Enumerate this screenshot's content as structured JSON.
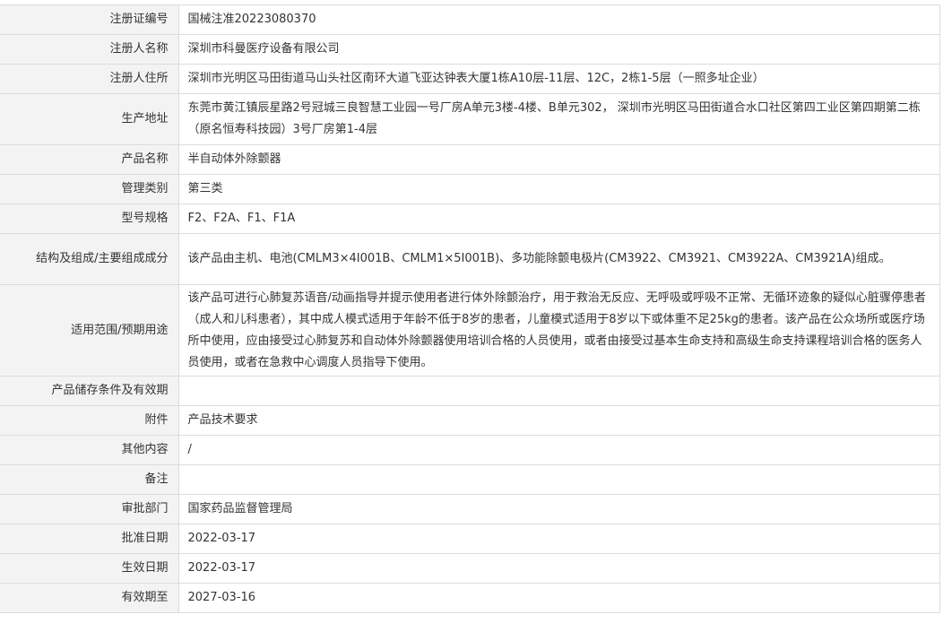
{
  "record": {
    "rows": [
      {
        "label": "注册证编号",
        "value": "国械注准20223080370"
      },
      {
        "label": "注册人名称",
        "value": "深圳市科曼医疗设备有限公司"
      },
      {
        "label": "注册人住所",
        "value": "深圳市光明区马田街道马山头社区南环大道飞亚达钟表大厦1栋A10层-11层、12C，2栋1-5层（一照多址企业）"
      },
      {
        "label": "生产地址",
        "value": "东莞市黄江镇辰星路2号冠城三良智慧工业园一号厂房A单元3楼-4楼、B单元302， 深圳市光明区马田街道合水口社区第四工业区第四期第二栋（原名恒寿科技园）3号厂房第1-4层"
      },
      {
        "label": "产品名称",
        "value": "半自动体外除颤器"
      },
      {
        "label": "管理类别",
        "value": "第三类"
      },
      {
        "label": "型号规格",
        "value": "F2、F2A、F1、F1A"
      },
      {
        "label": "结构及组成/主要组成成分",
        "value": "该产品由主机、电池(CMLM3×4I001B、CMLM1×5I001B)、多功能除颤电极片(CM3922、CM3921、CM3922A、CM3921A)组成。"
      },
      {
        "label": "适用范围/预期用途",
        "value": "该产品可进行心肺复苏语音/动画指导并提示使用者进行体外除颤治疗，用于救治无反应、无呼吸或呼吸不正常、无循环迹象的疑似心脏骤停患者（成人和儿科患者），其中成人模式适用于年龄不低于8岁的患者，儿童模式适用于8岁以下或体重不足25kg的患者。该产品在公众场所或医疗场所中使用，应由接受过心肺复苏和自动体外除颤器使用培训合格的人员使用，或者由接受过基本生命支持和高级生命支持课程培训合格的医务人员使用，或者在急救中心调度人员指导下使用。"
      },
      {
        "label": "产品储存条件及有效期",
        "value": ""
      },
      {
        "label": "附件",
        "value": "产品技术要求"
      },
      {
        "label": "其他内容",
        "value": "/"
      },
      {
        "label": "备注",
        "value": ""
      },
      {
        "label": "审批部门",
        "value": "国家药品监督管理局"
      },
      {
        "label": "批准日期",
        "value": "2022-03-17"
      },
      {
        "label": "生效日期",
        "value": "2022-03-17"
      },
      {
        "label": "有效期至",
        "value": "2027-03-16"
      }
    ]
  }
}
